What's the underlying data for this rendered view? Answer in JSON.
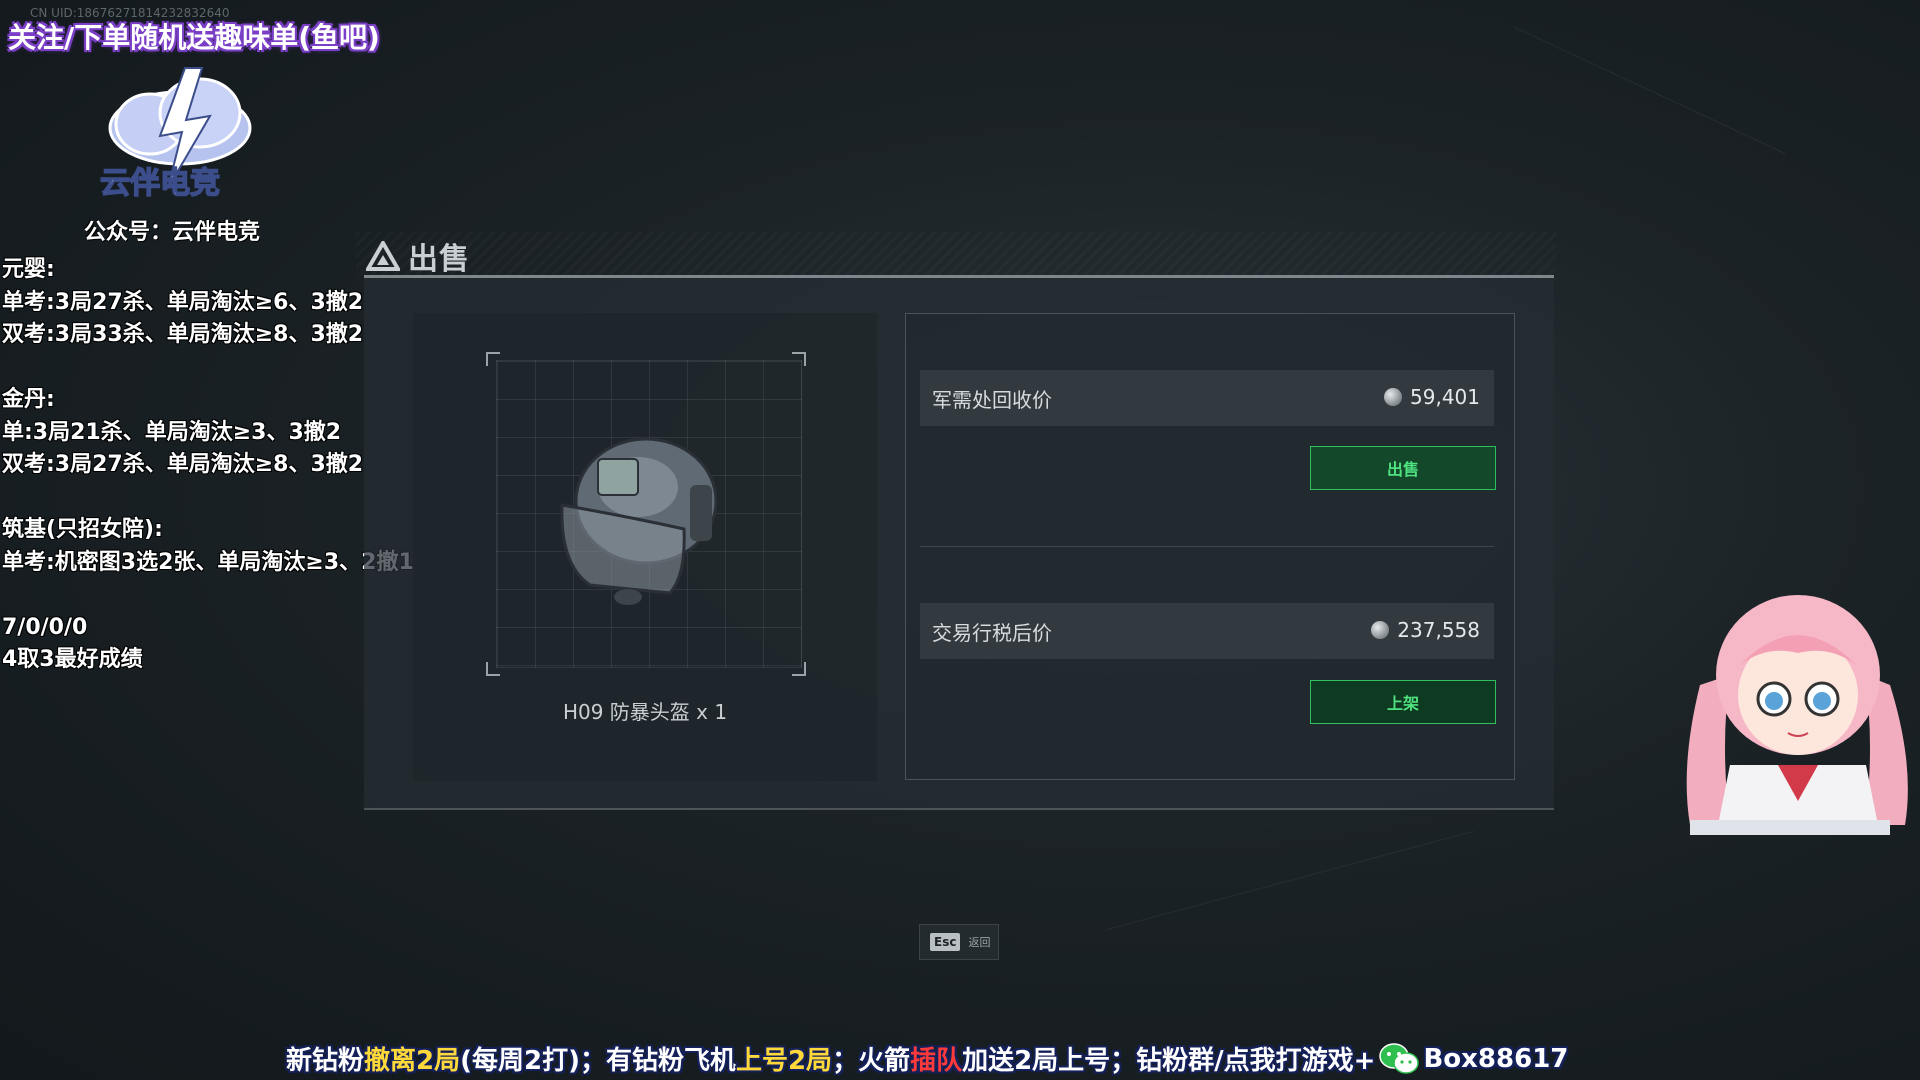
{
  "overlay": {
    "uid": "CN UID:18676271814232832640",
    "top_banner": "关注/下单随机送趣味单(鱼吧)",
    "logo_text": "云伴电竞",
    "logo_sub": "公众号：云伴电竞",
    "side_lines": [
      "元婴:",
      "单考:3局27杀、单局淘汰≥6、3撤2",
      "双考:3局33杀、单局淘汰≥8、3撤2",
      "",
      "金丹:",
      "单:3局21杀、单局淘汰≥3、3撤2",
      "双考:3局27杀、单局淘汰≥8、3撤2",
      "",
      "筑基(只招女陪):",
      "单考:机密图3选2张、单局淘汰≥3、2撤1",
      "",
      "7/0/0/0",
      "4取3最好成绩"
    ],
    "bottom_banner": {
      "p1": "新钻粉 ",
      "p2": "撤离2局",
      "p3": "(每周2打)；有钻粉飞机 ",
      "p4": "上号2局",
      "p5": "；火箭 ",
      "p6": "插队",
      "p7": " 加送2局上号；钻粉群/点我打游戏+",
      "p8": "Box88617"
    }
  },
  "panel": {
    "title": "出售",
    "item_name": "H09 防暴头盔 x 1",
    "recycle": {
      "label": "军需处回收价",
      "value": "59,401",
      "button": "出售"
    },
    "market": {
      "label": "交易行税后价",
      "value": "237,558",
      "button": "上架"
    }
  },
  "footer": {
    "esc_key": "Esc",
    "esc_label": "返回"
  },
  "colors": {
    "accent_green": "#4fe27f",
    "banner_yellow": "#ffd93a",
    "banner_red": "#ff3a3a"
  }
}
